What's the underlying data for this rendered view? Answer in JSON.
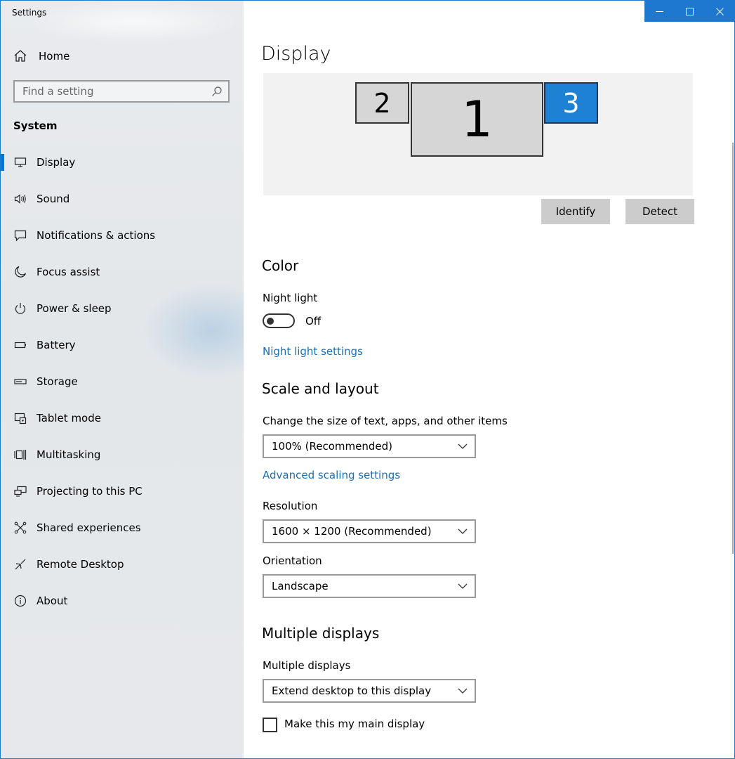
{
  "window": {
    "title": "Settings",
    "accent": "#0078d7"
  },
  "sidebar": {
    "home_label": "Home",
    "search_placeholder": "Find a setting",
    "section": "System",
    "items": [
      {
        "label": "Display",
        "icon": "monitor-icon",
        "selected": true
      },
      {
        "label": "Sound",
        "icon": "speaker-icon"
      },
      {
        "label": "Notifications & actions",
        "icon": "notification-icon"
      },
      {
        "label": "Focus assist",
        "icon": "moon-icon"
      },
      {
        "label": "Power & sleep",
        "icon": "power-icon"
      },
      {
        "label": "Battery",
        "icon": "battery-icon"
      },
      {
        "label": "Storage",
        "icon": "storage-icon"
      },
      {
        "label": "Tablet mode",
        "icon": "tablet-icon"
      },
      {
        "label": "Multitasking",
        "icon": "multitasking-icon"
      },
      {
        "label": "Projecting to this PC",
        "icon": "projector-icon"
      },
      {
        "label": "Shared experiences",
        "icon": "share-icon"
      },
      {
        "label": "Remote Desktop",
        "icon": "remote-desktop-icon"
      },
      {
        "label": "About",
        "icon": "info-icon"
      }
    ]
  },
  "main": {
    "title": "Display",
    "monitors": [
      {
        "number": "2",
        "selected": false
      },
      {
        "number": "1",
        "selected": false
      },
      {
        "number": "3",
        "selected": true
      }
    ],
    "identify_label": "Identify",
    "detect_label": "Detect",
    "color": {
      "heading": "Color",
      "night_light_label": "Night light",
      "night_light_state": "Off",
      "night_light_settings_link": "Night light settings"
    },
    "scale": {
      "heading": "Scale and layout",
      "size_label": "Change the size of text, apps, and other items",
      "size_value": "100% (Recommended)",
      "advanced_link": "Advanced scaling settings",
      "resolution_label": "Resolution",
      "resolution_value": "1600 × 1200 (Recommended)",
      "orientation_label": "Orientation",
      "orientation_value": "Landscape"
    },
    "multiple": {
      "heading": "Multiple displays",
      "label": "Multiple displays",
      "value": "Extend desktop to this display",
      "main_display_label": "Make this my main display",
      "main_display_checked": false
    }
  }
}
